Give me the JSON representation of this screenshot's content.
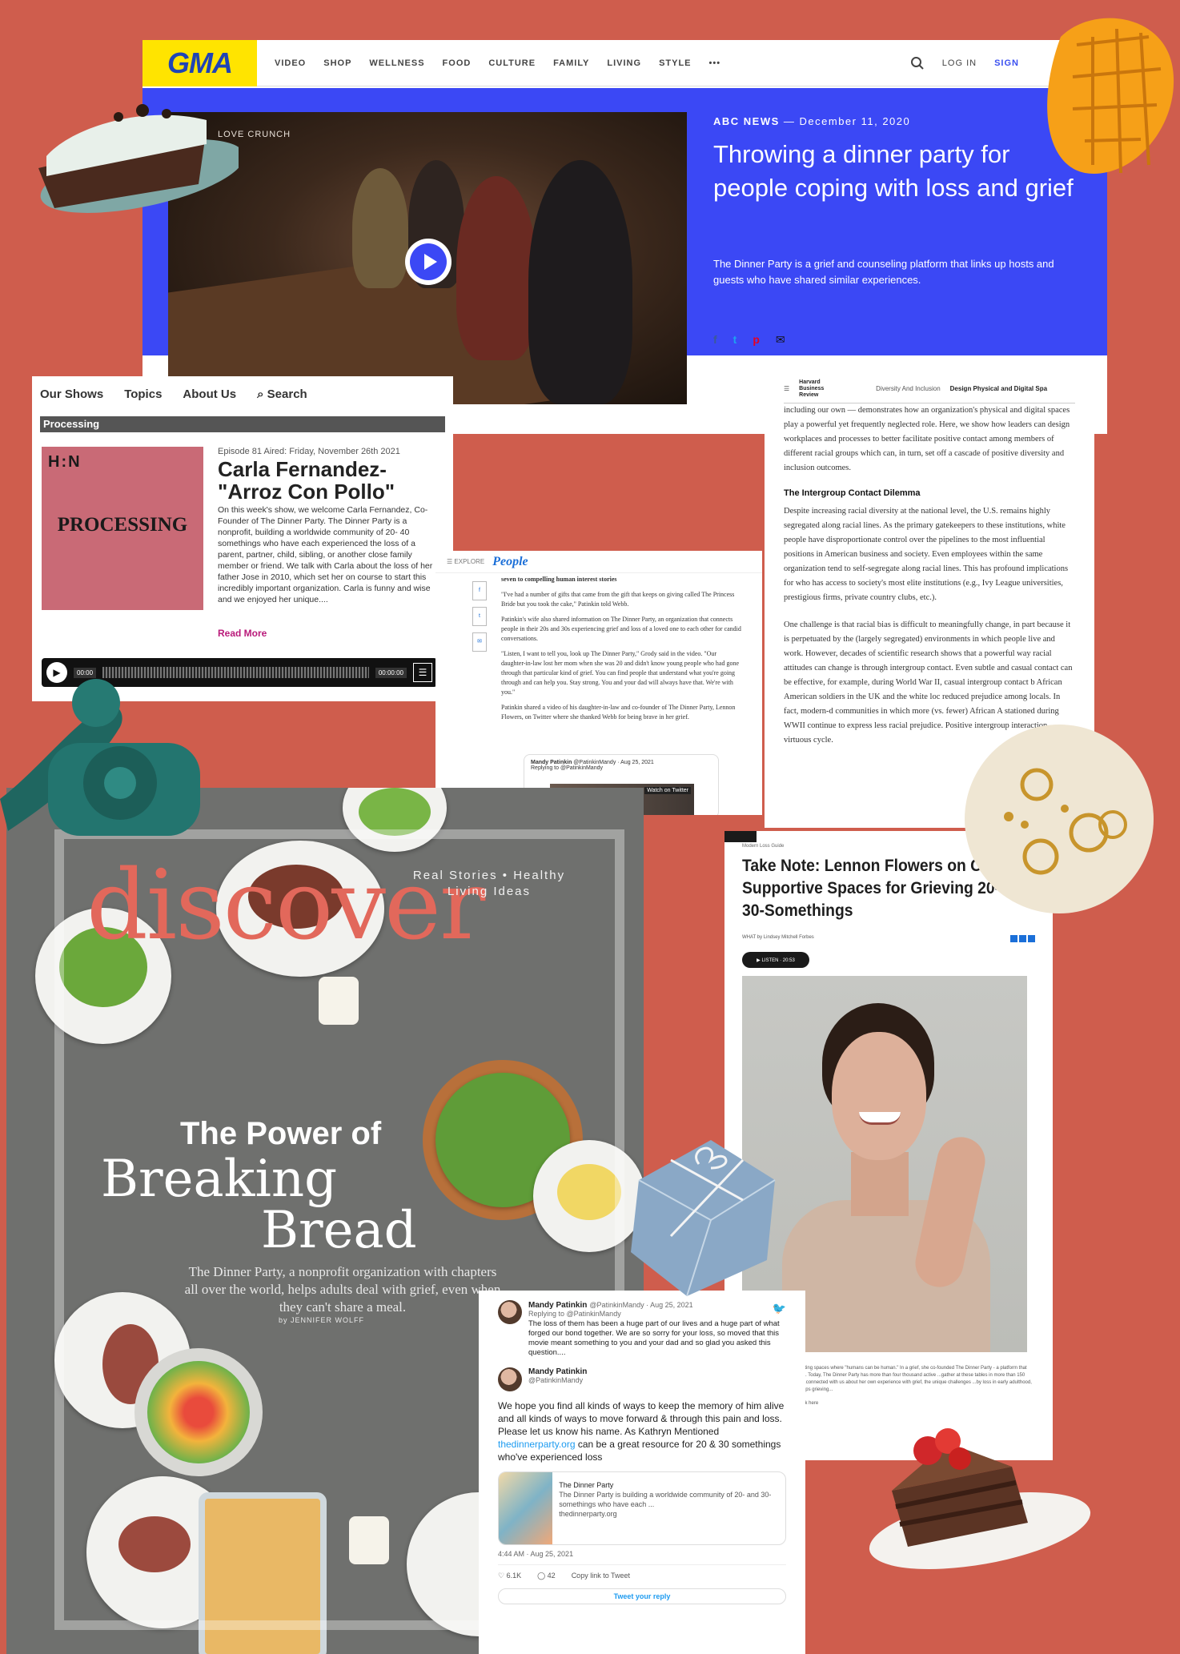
{
  "gma": {
    "logo": "GMA",
    "nav": [
      "VIDEO",
      "SHOP",
      "WELLNESS",
      "FOOD",
      "CULTURE",
      "FAMILY",
      "LIVING",
      "STYLE",
      "•••"
    ],
    "login": "LOG IN",
    "signup": "SIGN",
    "video_overlay": "LOVE CRUNCH",
    "source": "ABC NEWS",
    "date": "— December 11, 2020",
    "headline": "Throwing a dinner party for people coping with loss and grief",
    "dek": "The Dinner Party is a grief and counseling platform that links up hosts and guests who have shared similar experiences.",
    "share_icons": [
      "f",
      "t",
      "p",
      "✉"
    ]
  },
  "hbr": {
    "logo": "Harvard Business Review",
    "tag1": "Diversity And Inclusion",
    "tag2": "Design Physical and Digital Spa",
    "p1": "including our own — demonstrates how an organization's physical and digital spaces play a powerful yet frequently neglected role. Here, we show how leaders can design workplaces and processes to better facilitate positive contact among members of different racial groups which can, in turn, set off a cascade of positive diversity and inclusion outcomes.",
    "h1": "The Intergroup Contact Dilemma",
    "p2": "Despite increasing racial diversity at the national level, the U.S. remains highly segregated along racial lines. As the primary gatekeepers to these institutions, white people have disproportionate control over the pipelines to the most influential positions in American business and society. Even employees within the same organization tend to self-segregate along racial lines. This has profound implications for who has access to society's most elite institutions (e.g., Ivy League universities, prestigious firms, private country clubs, etc.).",
    "p3": "One challenge is that racial bias is difficult to meaningfully change, in part because it is perpetuated by the (largely segregated) environments in which people live and work. However, decades of scientific research shows that a powerful way racial attitudes can change is through intergroup contact. Even subtle and casual contact can be effective, for example, during World War II, casual intergroup contact b African American soldiers in the UK and the white loc reduced prejudice among locals. In fact, modern-d communities in which more (vs. fewer) African A stationed during WWII continue to express less racial prejudice. Positive intergroup interaction virtuous cycle."
  },
  "processing": {
    "nav": [
      "Our Shows",
      "Topics",
      "About Us",
      "⌕ Search"
    ],
    "bar": "Processing",
    "art_top": "H:N",
    "art_word": "PROCESSING",
    "episode": "Episode 81 Aired: Friday, November 26th 2021",
    "title": "Carla Fernandez- \"Arroz Con Pollo\"",
    "description": "On this week's show, we welcome Carla Fernandez, Co-Founder of The Dinner Party. The Dinner Party is a nonprofit, building a worldwide community of 20- 40 somethings who have each experienced the loss of a parent, partner, child, sibling, or another close family member or friend. We talk with Carla about the loss of her father Jose in 2010, which set her on course to start this incredibly important organization. Carla is funny and wise and we enjoyed her unique....",
    "read_more": "Read More",
    "play": "▶",
    "time_start": "00:00",
    "time_end": "00:00:00",
    "menu": "☰"
  },
  "people": {
    "logo": "People",
    "menu": "☰ EXPLORE",
    "share": [
      "f",
      "t",
      "✉"
    ],
    "p0": "seven to compelling human interest stories",
    "p1": "\"I've had a number of gifts that came from the gift that keeps on giving called The Princess Bride but you took the cake,\" Patinkin told Webb.",
    "p2": "Patinkin's wife also shared information on The Dinner Party, an organization that connects people in their 20s and 30s experiencing grief and loss of a loved one to each other for candid conversations.",
    "p3": "\"Listen, I want to tell you, look up The Dinner Party,\" Grody said in the video. \"Our daughter-in-law lost her mom when she was 20 and didn't know young people who had gone through that particular kind of grief. You can find people that understand what you're going through and can help you. Stay strong. You and your dad will always have that. We're with you.\"",
    "p4": "Patinkin shared a video of his daughter-in-law and co-founder of The Dinner Party, Lennon Flowers, on Twitter where she thanked Webb for being brave in her grief.",
    "tweet_name": "Mandy Patinkin",
    "tweet_handle": "@PatinkinMandy · Aug 25, 2021",
    "tweet_reply": "Replying to @PatinkinMandy",
    "tweet_watch": "Watch on Twitter"
  },
  "lennon": {
    "kicker": "Modern Loss Guide",
    "headline": "Take Note: Lennon Flowers on Creating Supportive Spaces for Grieving 20- and 30-Somethings",
    "byline": "WHAT by Lindsey Mitchell Forbes",
    "listen": "▶ LISTEN · 20:53",
    "caption": "...en is passionate about creating spaces where \"humans can be human.\" In a grief, she co-founded The Dinner Party - a platform that connects grieving somethings. Today, The Dinner Party has more than four thousand active ...gather at these tables in more than 150 cities and towns around the ...connected with us about her own experience with grief, the unique challenges ...by loss in early adulthood, and how The Dinner Party helps grieving...",
    "caption2": "...about The Dinner Party, click here",
    "caption3": "...tions"
  },
  "discover": {
    "title": "discover",
    "tagline": "Real Stories • Healthy Living Ideas",
    "pow1": "The Power of",
    "pow2": "Breaking",
    "pow3": "Bread",
    "subdek": "The Dinner Party, a nonprofit organization with chapters all over the world, helps adults deal with grief, even when they can't share a meal.",
    "author": "by JENNIFER WOLFF"
  },
  "tweet": {
    "name": "Mandy Patinkin",
    "handle": "@PatinkinMandy · Aug 25, 2021",
    "replying": "Replying to @PatinkinMandy",
    "text1": "The loss of them has been a huge part of our lives and a huge part of what forged our bond together. We are so sorry for your loss, so moved that this movie meant something to you and your dad and so glad you asked this question....",
    "name2": "Mandy Patinkin",
    "handle2": "@PatinkinMandy",
    "text2a": "We hope you find all kinds of ways to keep the memory of him alive and all kinds of ways to move forward & through this pain and loss. Please let us know his name. As Kathryn Mentioned ",
    "link": "thedinnerparty.org",
    "text2b": " can be a great resource for 20 & 30 somethings who've experienced loss",
    "card_title": "The Dinner Party",
    "card_desc": "The Dinner Party is building a worldwide community of 20- and 30-somethings who have each ...",
    "card_url": "thedinnerparty.org",
    "timestamp": "4:44 AM · Aug 25, 2021",
    "likes": "♡ 6.1K",
    "replies": "◯ 42",
    "copy": "Copy link to Tweet",
    "reply_btn": "Tweet your reply"
  }
}
